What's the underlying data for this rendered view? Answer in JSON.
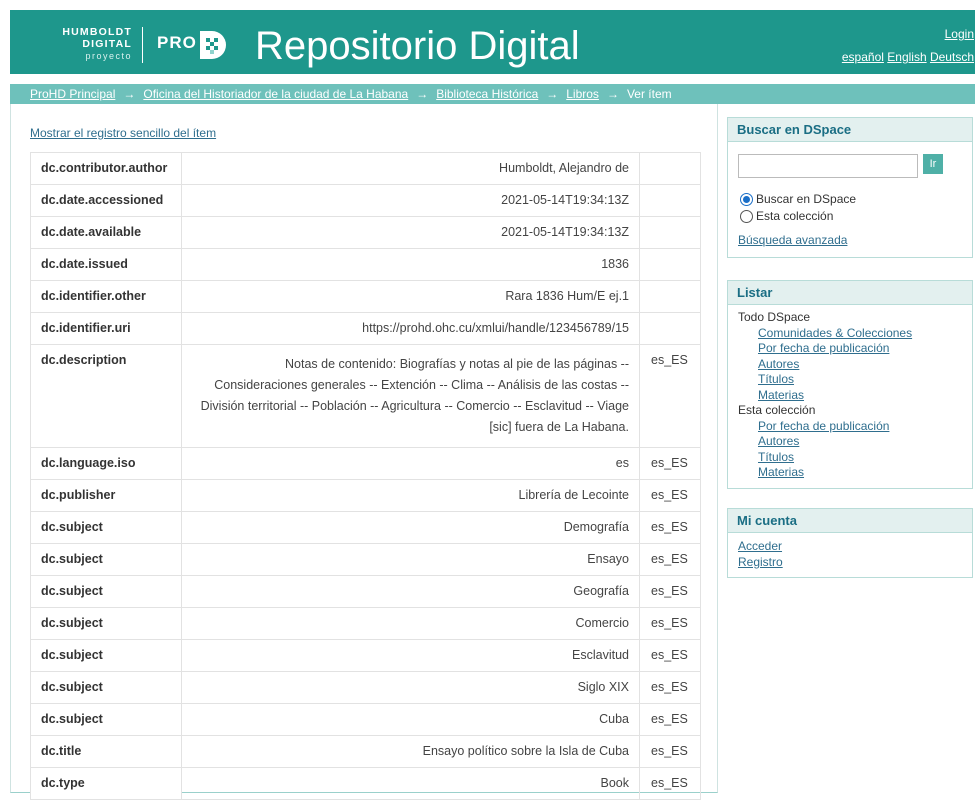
{
  "header": {
    "logo_line1": "HUMBOLDT",
    "logo_line2": "DIGITAL",
    "logo_line3": "proyecto",
    "logo_pro": "PRO",
    "logo_d_icon": "prohd-d-icon",
    "site_title": "Repositorio Digital",
    "login": "Login",
    "languages": [
      "español",
      "English",
      "Deutsch"
    ],
    "bg_color": "#1e978c"
  },
  "breadcrumb": {
    "items": [
      "ProHD Principal",
      "Oficina del Historiador de la ciudad de La Habana",
      "Biblioteca Histórica",
      "Libros"
    ],
    "current": "Ver ítem",
    "arrow": "→"
  },
  "main": {
    "simple_record_link": "Mostrar el registro sencillo del ítem",
    "rows": [
      {
        "field": "dc.contributor.author",
        "value": "Humboldt, Alejandro de",
        "lang": ""
      },
      {
        "field": "dc.date.accessioned",
        "value": "2021-05-14T19:34:13Z",
        "lang": ""
      },
      {
        "field": "dc.date.available",
        "value": "2021-05-14T19:34:13Z",
        "lang": ""
      },
      {
        "field": "dc.date.issued",
        "value": "1836",
        "lang": ""
      },
      {
        "field": "dc.identifier.other",
        "value": "Rara 1836 Hum/E ej.1",
        "lang": ""
      },
      {
        "field": "dc.identifier.uri",
        "value": "https://prohd.ohc.cu/xmlui/handle/123456789/15",
        "lang": ""
      },
      {
        "field": "dc.description",
        "value": "Notas de contenido: Biografías y notas al pie de las páginas -- Consideraciones generales -- Extención -- Clima -- Análisis de las costas -- División territorial -- Población -- Agricultura -- Comercio -- Esclavitud -- Viage [sic] fuera de La Habana.",
        "lang": "es_ES"
      },
      {
        "field": "dc.language.iso",
        "value": "es",
        "lang": "es_ES"
      },
      {
        "field": "dc.publisher",
        "value": "Librería de Lecointe",
        "lang": "es_ES"
      },
      {
        "field": "dc.subject",
        "value": "Demografía",
        "lang": "es_ES"
      },
      {
        "field": "dc.subject",
        "value": "Ensayo",
        "lang": "es_ES"
      },
      {
        "field": "dc.subject",
        "value": "Geografía",
        "lang": "es_ES"
      },
      {
        "field": "dc.subject",
        "value": "Comercio",
        "lang": "es_ES"
      },
      {
        "field": "dc.subject",
        "value": "Esclavitud",
        "lang": "es_ES"
      },
      {
        "field": "dc.subject",
        "value": "Siglo XIX",
        "lang": "es_ES"
      },
      {
        "field": "dc.subject",
        "value": "Cuba",
        "lang": "es_ES"
      },
      {
        "field": "dc.title",
        "value": "Ensayo político sobre la Isla de Cuba",
        "lang": "es_ES"
      },
      {
        "field": "dc.type",
        "value": "Book",
        "lang": "es_ES"
      }
    ]
  },
  "sidebar": {
    "search": {
      "title": "Buscar en DSpace",
      "input_value": "",
      "button": "Ir",
      "radio_all": "Buscar en DSpace",
      "radio_collection": "Esta colección",
      "selected": "all",
      "advanced": "Búsqueda avanzada"
    },
    "browse": {
      "title": "Listar",
      "all_label": "Todo DSpace",
      "all_links": [
        "Comunidades & Colecciones",
        "Por fecha de publicación",
        "Autores",
        "Títulos",
        "Materias"
      ],
      "collection_label": "Esta colección",
      "collection_links": [
        "Por fecha de publicación",
        "Autores",
        "Títulos",
        "Materias"
      ]
    },
    "account": {
      "title": "Mi cuenta",
      "links": [
        "Acceder",
        "Registro"
      ]
    }
  }
}
